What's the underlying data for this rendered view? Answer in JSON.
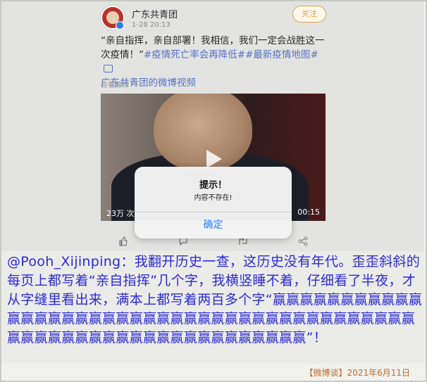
{
  "post": {
    "account_name": "广东共青团",
    "timestamp": "1-28 20:13",
    "follow_label": "关注",
    "text_main": "“亲自指挥，亲自部署！我相信，我们一定会战胜这一次疫情！”",
    "hashtags": "#疫情死亡率会再降低##最新疫情地图#",
    "video_link": "广东共青团的微博视频",
    "translate_label": "查看翻译",
    "video_views": "23万 次",
    "video_duration": "00:15"
  },
  "alert": {
    "title": "提示！",
    "message": "内容不存在!",
    "ok_label": "确定"
  },
  "commentary": {
    "text": "@Pooh_Xijinping：我翻开历史一查，这历史没有年代。歪歪斜斜的每页上都写着“亲自指挥”几个字，我横竖睡不着，仔细看了半夜，才从字缝里看出来，满本上都写着两百多个字“赢赢赢赢赢赢赢赢赢赢赢赢赢赢赢赢赢赢赢赢赢赢赢赢赢赢赢赢赢赢赢赢赢赢赢赢赢赢赢赢赢赢赢赢赢赢赢赢赢赢赢赢赢赢赢赢赢赢赢赢赢赢赢”！"
  },
  "source": "【微博谈】2021年6月11日",
  "colors": {
    "accent_link": "#5572c4",
    "commentary_text": "#2b2bd8",
    "follow_orange": "#e2a247",
    "alert_button": "#2f7ef0"
  }
}
